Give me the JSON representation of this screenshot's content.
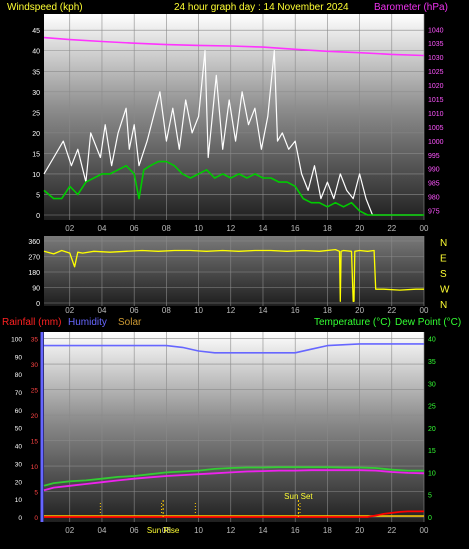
{
  "header": {
    "windspeed_label": "Windspeed (kph)",
    "graph_title": "24 hour graph day : 14 November 2024",
    "barometer_label": "Barometer (hPa)"
  },
  "bottom_header": {
    "rainfall_label": "Rainfall (mm)",
    "humidity_label": "Humidity",
    "solar_label": "Solar",
    "temperature_label": "Temperature (°C)",
    "dewpoint_label": "Dew Point (°C)"
  },
  "sun_labels": {
    "sunrise": "Sun Rise",
    "sunset": "Sun Set"
  },
  "colors": {
    "background": "#000000",
    "grid": "#8a8a8a",
    "wind_speed": "#ffffff",
    "wind_avg": "#00cc00",
    "barometer": "#ff33ff",
    "wind_dir": "#ffff00",
    "humidity": "#6666ff",
    "temperature": "#33cc33",
    "dewpoint": "#ee22ee",
    "rainfall": "#ff0000",
    "solar": "#ffcc00",
    "header_yellow": "#ffff33",
    "header_magenta": "#ee33ee",
    "label_red": "#ff2222",
    "label_blue": "#6666ff",
    "label_tan": "#cc9933",
    "label_green": "#33ff33",
    "axis_tick_left": "#ff4444",
    "axis_tick_right": "#33ff33"
  },
  "chart_data": [
    {
      "type": "line",
      "name": "wind-barometer",
      "x_ticks": [
        "02",
        "04",
        "06",
        "08",
        "10",
        "12",
        "14",
        "16",
        "18",
        "20",
        "22",
        "00"
      ],
      "y_left_ticks": [
        "0",
        "5",
        "10",
        "15",
        "20",
        "25",
        "30",
        "35",
        "40",
        "45"
      ],
      "y_right_ticks": [
        "975",
        "980",
        "985",
        "990",
        "995",
        "1000",
        "1005",
        "1010",
        "1015",
        "1020",
        "1025",
        "1030",
        "1035",
        "1040"
      ],
      "ylim_left": [
        0,
        47
      ],
      "ylim_right": [
        973.4,
        1042.6
      ],
      "xlim_hours": [
        0.4,
        24
      ],
      "series": [
        {
          "name": "Windspeed (kph)",
          "axis": "left",
          "x": [
            0.4,
            1.0,
            1.6,
            2.1,
            2.5,
            3.0,
            3.3,
            3.9,
            4.2,
            4.6,
            5.0,
            5.5,
            5.7,
            6.0,
            6.3,
            6.8,
            7.2,
            7.6,
            8.0,
            8.4,
            8.8,
            9.2,
            9.6,
            10.0,
            10.4,
            10.6,
            10.8,
            11.1,
            11.5,
            11.9,
            12.3,
            12.7,
            13.1,
            13.5,
            13.9,
            14.3,
            14.7,
            14.9,
            15.2,
            15.6,
            16.0,
            16.4,
            16.8,
            17.2,
            17.6,
            18.0,
            18.4,
            18.8,
            19.2,
            19.6,
            20.0,
            20.4,
            20.8,
            21.3,
            21.8,
            22.3,
            22.8,
            23.3,
            23.9
          ],
          "values": [
            10,
            14,
            18,
            12,
            16,
            8,
            20,
            14,
            22,
            12,
            20,
            26,
            16,
            22,
            12,
            18,
            24,
            30,
            18,
            26,
            16,
            28,
            20,
            24,
            40,
            14,
            22,
            34,
            16,
            28,
            18,
            30,
            22,
            26,
            16,
            24,
            40,
            18,
            20,
            16,
            18,
            10,
            6,
            12,
            4,
            8,
            4,
            10,
            6,
            4,
            10,
            4,
            0,
            0,
            0,
            0,
            0,
            0,
            0
          ]
        },
        {
          "name": "Wind average (kph)",
          "axis": "left",
          "x": [
            0.4,
            1.0,
            1.5,
            2.0,
            2.5,
            3.0,
            3.5,
            4.0,
            4.5,
            5.0,
            5.5,
            6.0,
            6.3,
            6.6,
            7.0,
            7.5,
            8.0,
            8.5,
            9.0,
            9.5,
            10.0,
            10.5,
            11.0,
            11.5,
            12.0,
            12.5,
            13.0,
            13.5,
            14.0,
            14.5,
            15.0,
            15.5,
            16.0,
            16.5,
            17.0,
            17.5,
            18.0,
            18.5,
            19.0,
            19.5,
            20.0,
            20.5,
            21.0,
            21.5,
            22.0,
            22.5,
            23.0,
            23.5,
            24.0
          ],
          "values": [
            6,
            4,
            4,
            7,
            5,
            8,
            9,
            10,
            10,
            11,
            12,
            10,
            4,
            11,
            12,
            13,
            13,
            12,
            10,
            9,
            10,
            11,
            9,
            10,
            9,
            10,
            9,
            10,
            9,
            9,
            8,
            8,
            7,
            4,
            3,
            3,
            2,
            3,
            2,
            3,
            1,
            0,
            0,
            0,
            0,
            0,
            0,
            0,
            0
          ]
        },
        {
          "name": "Barometer (hPa)",
          "axis": "right",
          "x": [
            0.4,
            2,
            4,
            6,
            8,
            10,
            12,
            14,
            16,
            18,
            20,
            22,
            24
          ],
          "values": [
            1037.0,
            1036.3,
            1035.6,
            1035.0,
            1034.5,
            1034.2,
            1034.0,
            1033.6,
            1032.8,
            1032.1,
            1031.6,
            1031.0,
            1030.6
          ]
        }
      ]
    },
    {
      "type": "line",
      "name": "wind-direction",
      "x_ticks": [
        "02",
        "04",
        "06",
        "08",
        "10",
        "12",
        "14",
        "16",
        "18",
        "20",
        "22",
        "00"
      ],
      "y_left_ticks": [
        "0",
        "90",
        "180",
        "270",
        "360"
      ],
      "y_right_ticks": [
        "N",
        "E",
        "S",
        "W",
        "N"
      ],
      "ylim": [
        0,
        360
      ],
      "xlim_hours": [
        0.4,
        24
      ],
      "series": [
        {
          "name": "Wind direction (°)",
          "x": [
            0.4,
            1.0,
            1.5,
            2.0,
            2.3,
            2.5,
            2.8,
            3.5,
            4.5,
            5.5,
            6.5,
            7.5,
            8.5,
            9.5,
            10.5,
            11.5,
            12.5,
            13.5,
            14.5,
            15.5,
            16.5,
            17.5,
            18.5,
            18.75,
            18.8,
            18.85,
            19.0,
            19.5,
            19.6,
            19.65,
            19.7,
            20.0,
            20.5,
            20.9,
            21.0,
            21.5,
            22.5,
            23.5,
            24.0
          ],
          "values": [
            300,
            285,
            305,
            290,
            210,
            295,
            290,
            300,
            295,
            300,
            305,
            300,
            305,
            305,
            300,
            305,
            300,
            305,
            305,
            300,
            305,
            300,
            310,
            300,
            10,
            300,
            305,
            300,
            10,
            10,
            300,
            305,
            300,
            305,
            80,
            80,
            75,
            80,
            80
          ]
        }
      ]
    },
    {
      "type": "line",
      "name": "temperature-humidity",
      "x_ticks": [
        "02",
        "04",
        "06",
        "08",
        "10",
        "12",
        "14",
        "16",
        "18",
        "20",
        "22",
        "00"
      ],
      "y_left_ticks": [
        "0",
        "5",
        "10",
        "15",
        "20",
        "25",
        "30",
        "35"
      ],
      "y_humidity_ticks": [
        "0",
        "10",
        "20",
        "30",
        "40",
        "50",
        "60",
        "70",
        "80",
        "90",
        "100"
      ],
      "y_right_ticks": [
        "0",
        "5",
        "10",
        "15",
        "20",
        "25",
        "30",
        "35",
        "40"
      ],
      "ylim_left": [
        0,
        35.5
      ],
      "ylim_humidity": [
        0,
        101.4
      ],
      "ylim_right": [
        0,
        40.6
      ],
      "xlim_hours": [
        0.4,
        24
      ],
      "series": [
        {
          "name": "Humidity",
          "axis": "humidity",
          "x": [
            0.4,
            2,
            4,
            6,
            8,
            9,
            10,
            11,
            12,
            14,
            16,
            17,
            18,
            20,
            22,
            24
          ],
          "values": [
            96,
            96,
            96,
            96,
            96,
            95,
            93,
            92,
            92,
            92,
            92,
            94,
            96,
            97,
            97,
            97
          ]
        },
        {
          "name": "Temperature (°C)",
          "axis": "right",
          "x": [
            0.4,
            1,
            2,
            3,
            4,
            5,
            6,
            7,
            8,
            9,
            10,
            11,
            12,
            13,
            14,
            15,
            16,
            17,
            18,
            19,
            20,
            21,
            22,
            23,
            24
          ],
          "values": [
            7.0,
            7.6,
            8.0,
            8.2,
            8.6,
            9.0,
            9.2,
            9.6,
            10.0,
            10.2,
            10.4,
            10.8,
            11.0,
            11.1,
            11.1,
            11.2,
            11.2,
            11.2,
            11.2,
            11.1,
            11.1,
            11.0,
            10.6,
            10.4,
            10.4
          ]
        },
        {
          "name": "Dew Point (°C)",
          "axis": "right",
          "x": [
            0.4,
            1,
            2,
            3,
            4,
            5,
            6,
            7,
            8,
            9,
            10,
            11,
            12,
            13,
            14,
            15,
            16,
            17,
            18,
            19,
            20,
            21,
            22,
            23,
            24
          ],
          "values": [
            6.0,
            6.6,
            7.0,
            7.4,
            7.8,
            8.2,
            8.6,
            8.9,
            9.2,
            9.4,
            9.6,
            9.8,
            10.0,
            10.2,
            10.3,
            10.4,
            10.4,
            10.5,
            10.5,
            10.5,
            10.5,
            10.4,
            10.1,
            9.9,
            9.8
          ]
        },
        {
          "name": "Rainfall (mm)",
          "axis": "left",
          "x": [
            0.4,
            20.5,
            21.0,
            21.5,
            22.0,
            22.5,
            23.0,
            23.5,
            24.0
          ],
          "values": [
            0,
            0,
            0.3,
            0.6,
            0.8,
            1.0,
            1.1,
            1.1,
            1.1
          ]
        }
      ],
      "markers": [
        {
          "name": "Sun Rise",
          "x": 7.8
        },
        {
          "name": "Sun Set",
          "x": 16.2
        }
      ]
    }
  ]
}
